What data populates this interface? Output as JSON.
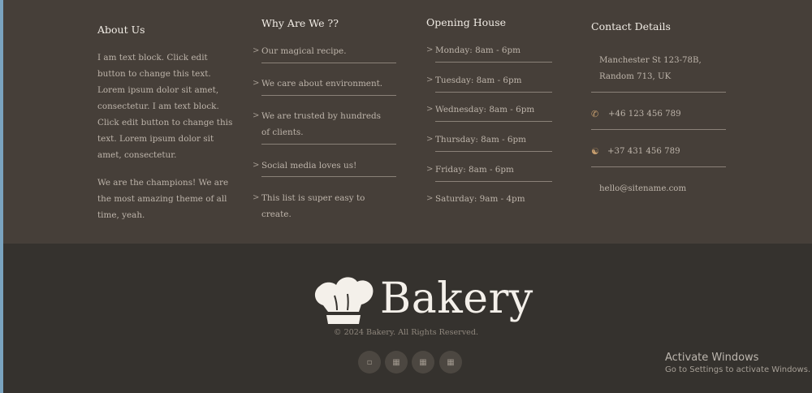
{
  "footer": {
    "about": {
      "title": "About Us",
      "paragraphs": [
        "I am text block. Click edit button to change this text. Lorem ipsum dolor sit amet, consectetur. I am text block. Click edit button to change this text. Lorem ipsum dolor sit amet, consectetur.",
        "We are the champions! We are the most amazing theme of all time, yeah."
      ]
    },
    "why": {
      "title": "Why Are We ??",
      "items": [
        "Our magical recipe.",
        "We care about environment.",
        "We are trusted by hundreds of clients.",
        "Social media loves us!",
        "This list is super easy to create."
      ]
    },
    "opening": {
      "title": "Opening House",
      "items": [
        "Monday: 8am - 6pm",
        "Tuesday: 8am - 6pm",
        "Wednesday: 8am - 6pm",
        "Thursday: 8am - 6pm",
        "Friday: 8am - 6pm",
        "Saturday: 9am - 4pm"
      ]
    },
    "contact": {
      "title": "Contact Details",
      "address": "Manchester St 123-78B, Random 713, UK",
      "phone": "+46 123 456 789",
      "support": "+37 431 456 789",
      "email": "hello@sitename.com"
    }
  },
  "brand": {
    "name": "Bakery",
    "copyright": "© 2024 Bakery. All Rights Reserved."
  },
  "social": {
    "icons": [
      "facebook-icon",
      "twitter-icon",
      "instagram-icon",
      "youtube-icon"
    ]
  },
  "windows": {
    "activate_title": "Activate Windows",
    "activate_subtitle": "Go to Settings to activate Windows."
  },
  "colors": {
    "top_bg": "#463f39",
    "bottom_bg": "#35322e",
    "accent": "#c89f6f"
  }
}
